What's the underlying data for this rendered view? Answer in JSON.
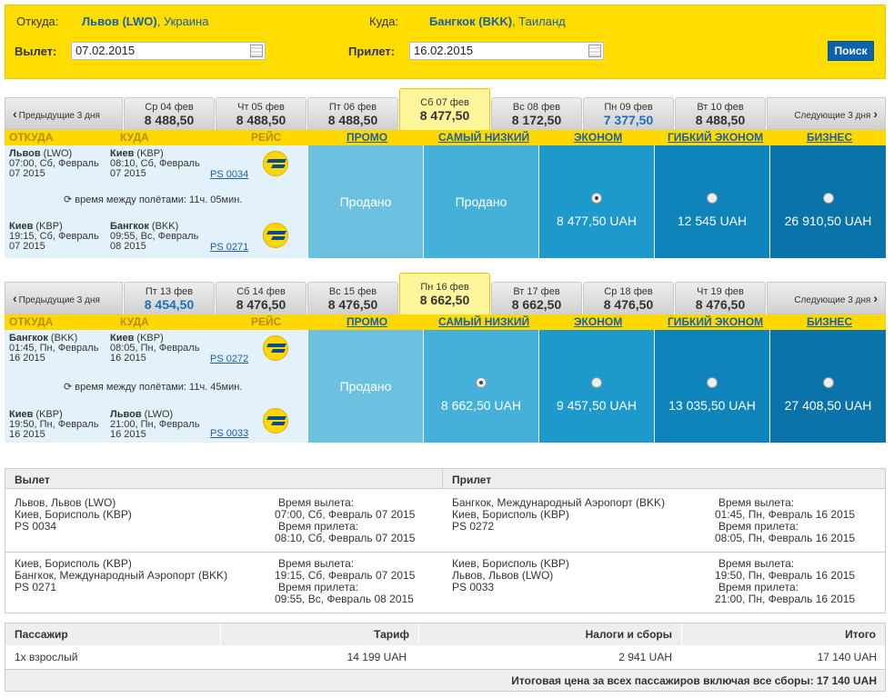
{
  "search": {
    "from_label": "Откуда:",
    "from_city": "Львов (LWO)",
    "from_country": ", Украина",
    "to_label": "Куда:",
    "to_city": "Бангкок (BKK)",
    "to_country": ", Таиланд",
    "depart_label": "Вылет:",
    "depart_value": "07.02.2015",
    "return_label": "Прилет:",
    "return_value": "16.02.2015",
    "button": "Поиск"
  },
  "headers": {
    "from": "ОТКУДА",
    "to": "КУДА",
    "flight": "РЕЙС",
    "promo": "ПРОМО",
    "lowest": "САМЫЙ НИЗКИЙ",
    "economy": "ЭКОНОМ",
    "flex": "ГИБКИЙ ЭКОНОМ",
    "business": "БИЗНЕС"
  },
  "outbound": {
    "prev": "Предыдущие 3 дня",
    "next": "Следующие 3 дня",
    "days": [
      {
        "d": "Ср 04 фев",
        "p": "8 488,50"
      },
      {
        "d": "Чт 05 фев",
        "p": "8 488,50"
      },
      {
        "d": "Пт 06 фев",
        "p": "8 488,50"
      },
      {
        "d": "Сб 07 фев",
        "p": "8 477,50"
      },
      {
        "d": "Вс 08 фев",
        "p": "8 172,50"
      },
      {
        "d": "Пн 09 фев",
        "p": "7 377,50"
      },
      {
        "d": "Вт 10 фев",
        "p": "8 488,50"
      }
    ],
    "seg1": {
      "from_city": "Львов",
      "from_code": " (LWO)",
      "from_time": "07:00, Сб, Февраль",
      "from_year": "07 2015",
      "to_city": "Киев",
      "to_code": " (KBP)",
      "to_time": "08:10, Сб, Февраль",
      "to_year": "07 2015",
      "flight": "PS 0034"
    },
    "between": "время между полётами: 11ч. 05мин.",
    "seg2": {
      "from_city": "Киев",
      "from_code": " (KBP)",
      "from_time": "19:15, Сб, Февраль",
      "from_year": "07 2015",
      "to_city": "Бангкок",
      "to_code": " (BKK)",
      "to_time": "09:55, Вс, Февраль",
      "to_year": "08 2015",
      "flight": "PS 0271"
    },
    "promo": "Продано",
    "lowest": "Продано",
    "economy": "8 477,50 UAH",
    "flex": "12 545 UAH",
    "business": "26 910,50 UAH"
  },
  "inbound": {
    "prev": "Предыдущие 3 дня",
    "next": "Следующие 3 дня",
    "days": [
      {
        "d": "Пт 13 фев",
        "p": "8 454,50"
      },
      {
        "d": "Сб 14 фев",
        "p": "8 476,50"
      },
      {
        "d": "Вс 15 фев",
        "p": "8 476,50"
      },
      {
        "d": "Пн 16 фев",
        "p": "8 662,50"
      },
      {
        "d": "Вт 17 фев",
        "p": "8 662,50"
      },
      {
        "d": "Ср 18 фев",
        "p": "8 476,50"
      },
      {
        "d": "Чт 19 фев",
        "p": "8 476,50"
      }
    ],
    "seg1": {
      "from_city": "Бангкок",
      "from_code": " (BKK)",
      "from_time": "01:45, Пн, Февраль",
      "from_year": "16 2015",
      "to_city": "Киев",
      "to_code": " (KBP)",
      "to_time": "08:05, Пн, Февраль",
      "to_year": "16 2015",
      "flight": "PS 0272"
    },
    "between": "время между полётами: 11ч. 45мин.",
    "seg2": {
      "from_city": "Киев",
      "from_code": " (KBP)",
      "from_time": "19:50, Пн, Февраль",
      "from_year": "16 2015",
      "to_city": "Львов",
      "to_code": " (LWO)",
      "to_time": "21:00, Пн, Февраль",
      "to_year": "16 2015",
      "flight": "PS 0033"
    },
    "promo": "Продано",
    "lowest": "8 662,50 UAH",
    "economy": "9 457,50 UAH",
    "flex": "13 035,50 UAH",
    "business": "27 408,50 UAH"
  },
  "details": {
    "dep_title": "Вылет",
    "arr_title": "Прилет",
    "dep1": [
      "Львов, Львов (LWO)",
      "Киев, Борисполь (KBP)",
      "PS 0034"
    ],
    "dep1_times": [
      "Время вылета:",
      "07:00, Сб, Февраль 07 2015",
      "Время прилета:",
      "08:10, Сб, Февраль 07 2015"
    ],
    "dep2": [
      "Киев, Борисполь (KBP)",
      "Бангкок, Международный Аэропорт (BKK)",
      "PS 0271"
    ],
    "dep2_times": [
      "Время вылета:",
      "19:15, Сб, Февраль 07 2015",
      "Время прилета:",
      "09:55, Вс, Февраль 08 2015"
    ],
    "arr1": [
      "Бангкок, Международный Аэропорт (BKK)",
      "Киев, Борисполь (KBP)",
      "PS 0272"
    ],
    "arr1_times": [
      "Время вылета:",
      "01:45, Пн, Февраль 16 2015",
      "Время прилета:",
      "08:05, Пн, Февраль 16 2015"
    ],
    "arr2": [
      "Киев, Борисполь (KBP)",
      "Львов, Львов (LWO)",
      "PS 0033"
    ],
    "arr2_times": [
      "Время вылета:",
      "19:50, Пн, Февраль 16 2015",
      "Время прилета:",
      "21:00, Пн, Февраль 16 2015"
    ]
  },
  "price": {
    "h_passenger": "Пассажир",
    "h_fare": "Тариф",
    "h_taxes": "Налоги и сборы",
    "h_total": "Итого",
    "passenger": "1x взрослый",
    "fare": "14 199 UAH",
    "taxes": "2 941 UAH",
    "total": "17 140 UAH",
    "grand_label": "Итоговая цена за всех пассажиров включая все сборы: ",
    "grand_value": "17 140 UAH"
  },
  "colors": {
    "yellow": "#ffdd00",
    "promo": "#6cc0e0",
    "lowest": "#45b0d8",
    "economy": "#1e99cc",
    "flex": "#0e84bb",
    "business": "#0a73aa"
  }
}
